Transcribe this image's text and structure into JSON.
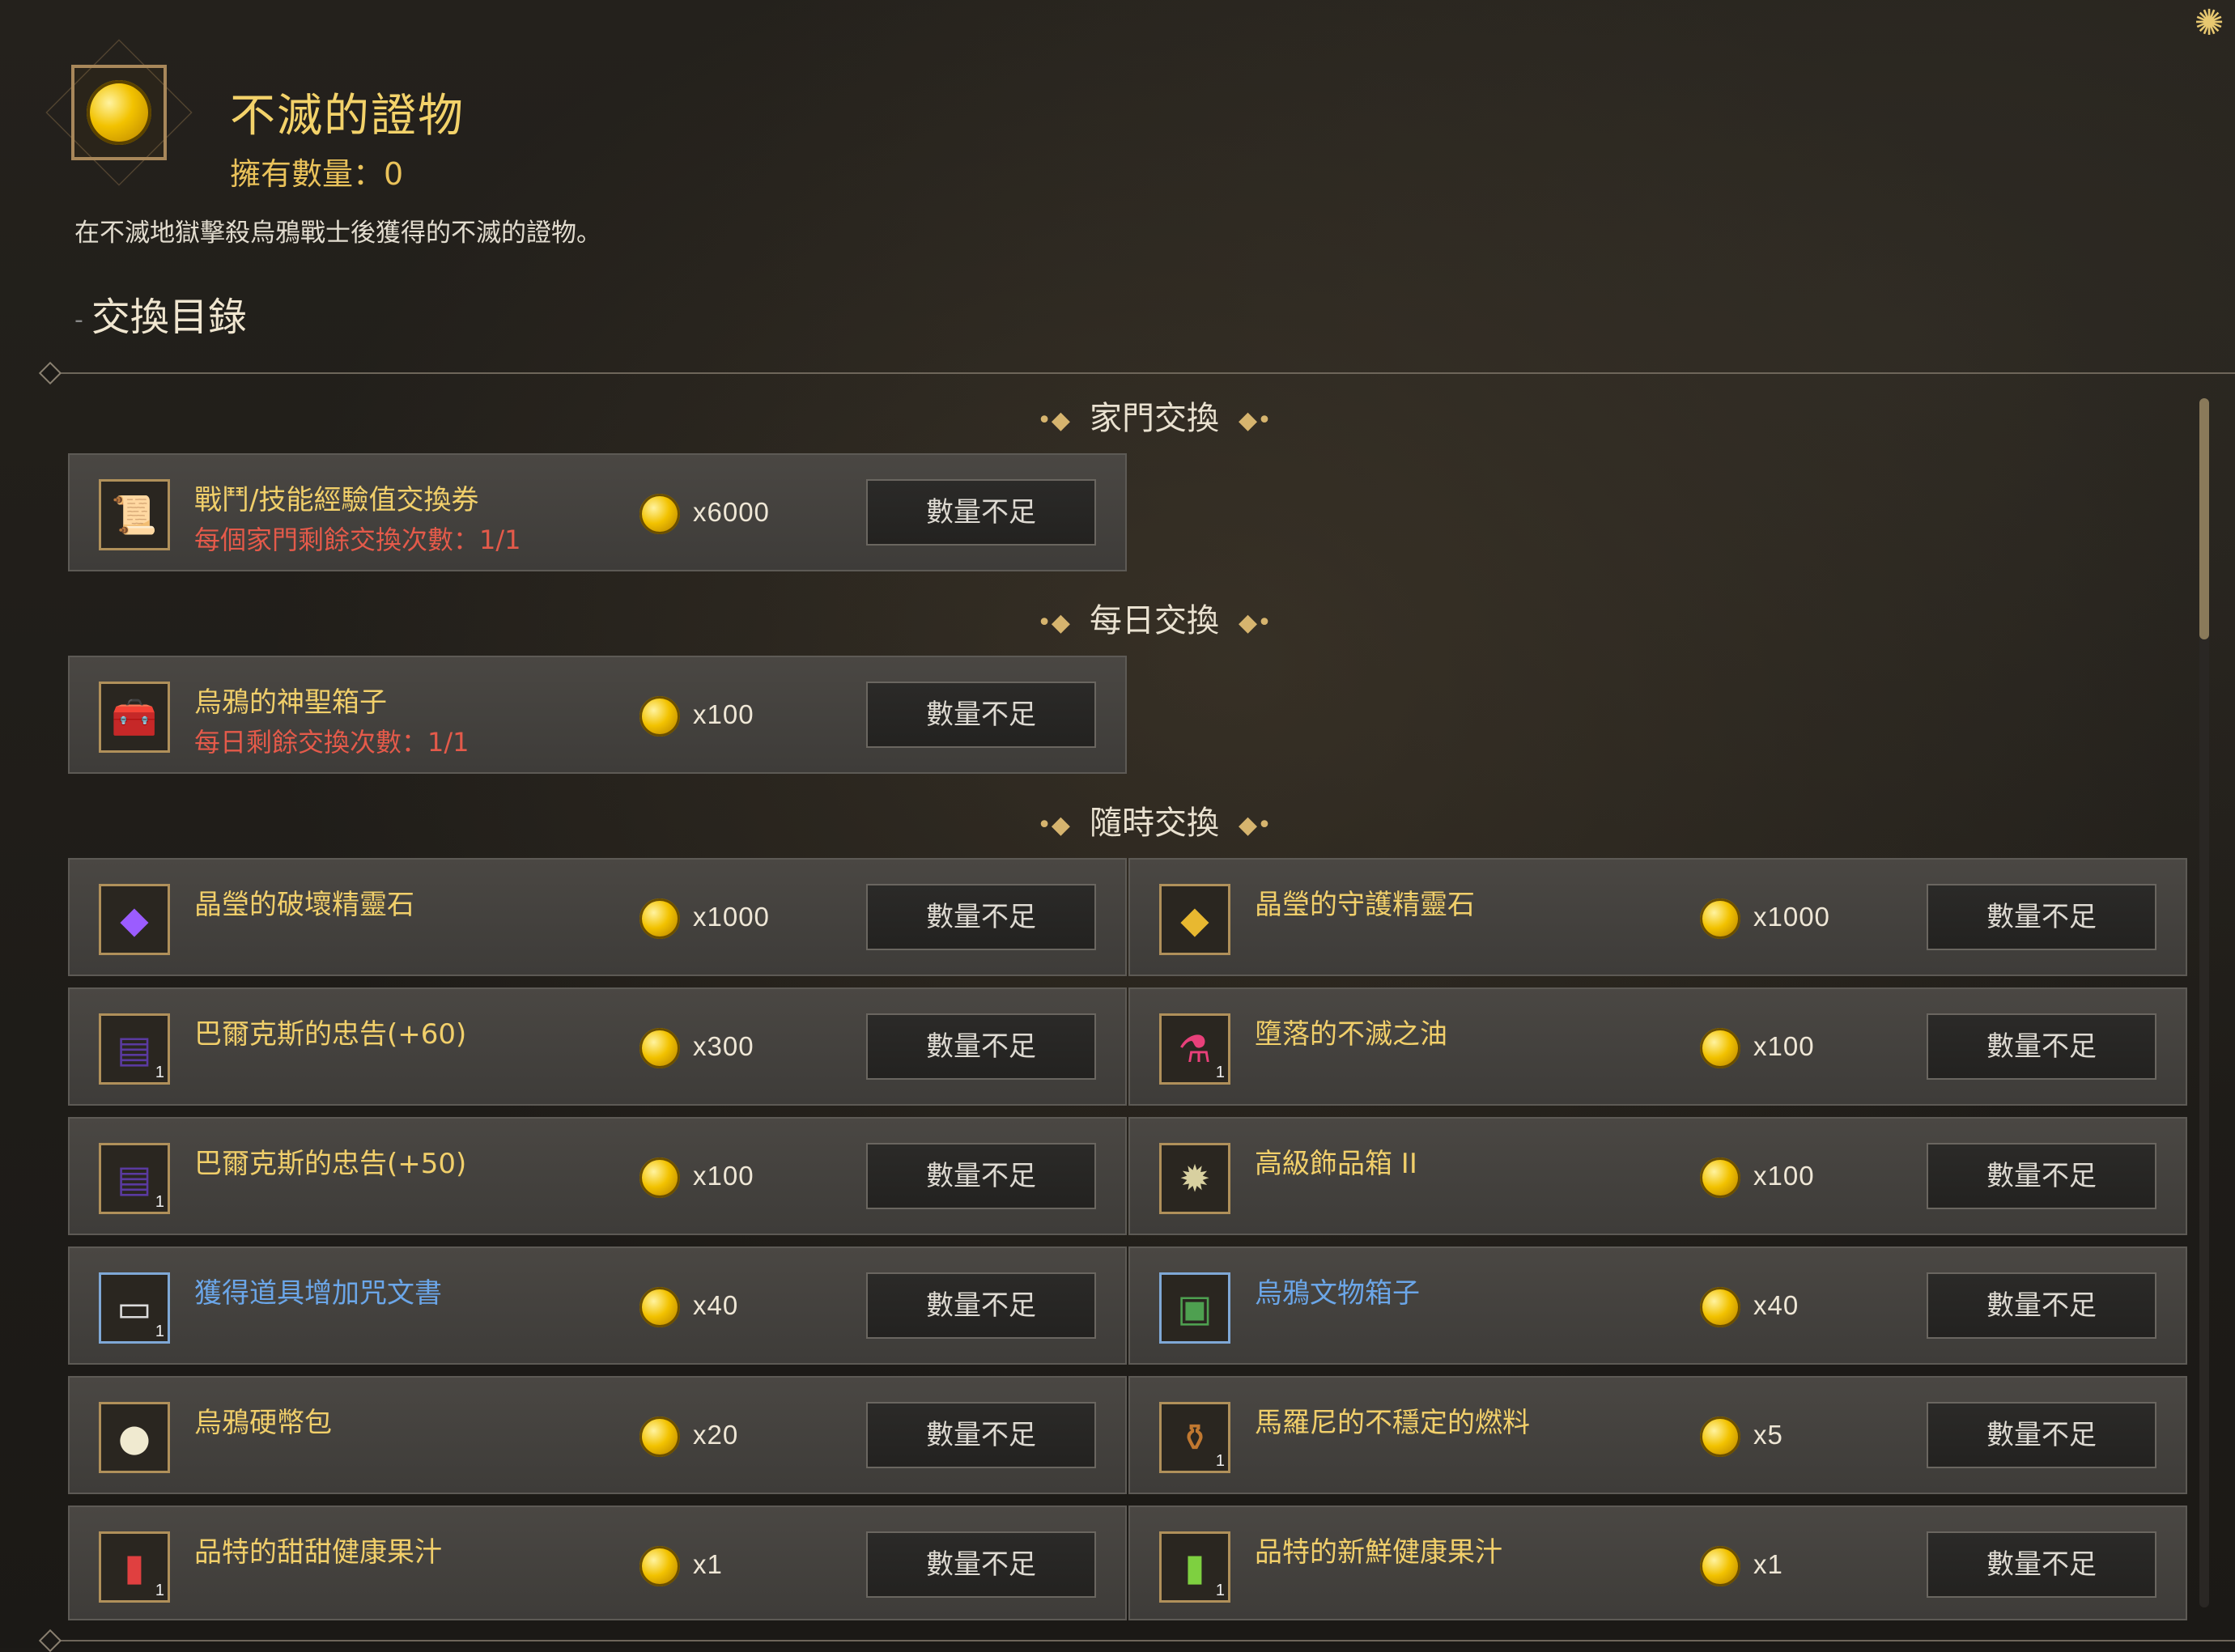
{
  "header": {
    "title": "不滅的證物",
    "owned": "擁有數量：0",
    "description": "在不滅地獄擊殺烏鴉戰士後獲得的不滅的證物。",
    "catalog_title": "交換目錄"
  },
  "sections": {
    "family": "家門交換",
    "daily": "每日交換",
    "anytime": "隨時交換"
  },
  "button_label": "數量不足",
  "items": [
    {
      "name": "戰鬥/技能經驗值交換券",
      "limit": "每個家門剩餘交換次數：1/1",
      "cost": "x6000",
      "icon": "scroll-icon"
    },
    {
      "name": "烏鴉的神聖箱子",
      "limit": "每日剩餘交換次數：1/1",
      "cost": "x100",
      "icon": "chest-icon"
    },
    {
      "name": "晶瑩的破壞精靈石",
      "cost": "x1000",
      "icon": "purple-gem-icon"
    },
    {
      "name": "晶瑩的守護精靈石",
      "cost": "x1000",
      "icon": "gold-gem-icon"
    },
    {
      "name": "巴爾克斯的忠告(+60)",
      "cost": "x300",
      "icon": "book-icon",
      "qty": "1"
    },
    {
      "name": "墮落的不滅之油",
      "cost": "x100",
      "icon": "potion-icon",
      "qty": "1"
    },
    {
      "name": "巴爾克斯的忠告(+50)",
      "cost": "x100",
      "icon": "book-icon",
      "qty": "1"
    },
    {
      "name": "高級飾品箱 II",
      "cost": "x100",
      "icon": "accessory-box-icon"
    },
    {
      "name": "獲得道具增加咒文書",
      "cost": "x40",
      "icon": "spell-scroll-icon",
      "qty": "1"
    },
    {
      "name": "烏鴉文物箱子",
      "cost": "x40",
      "icon": "relic-chest-icon"
    },
    {
      "name": "烏鴉硬幣包",
      "cost": "x20",
      "icon": "coin-pouch-icon"
    },
    {
      "name": "馬羅尼的不穩定的燃料",
      "cost": "x5",
      "icon": "fuel-bottle-icon",
      "qty": "1"
    },
    {
      "name": "品特的甜甜健康果汁",
      "cost": "x1",
      "icon": "red-juice-icon",
      "qty": "1"
    },
    {
      "name": "品特的新鮮健康果汁",
      "cost": "x1",
      "icon": "green-juice-icon",
      "qty": "1"
    }
  ]
}
